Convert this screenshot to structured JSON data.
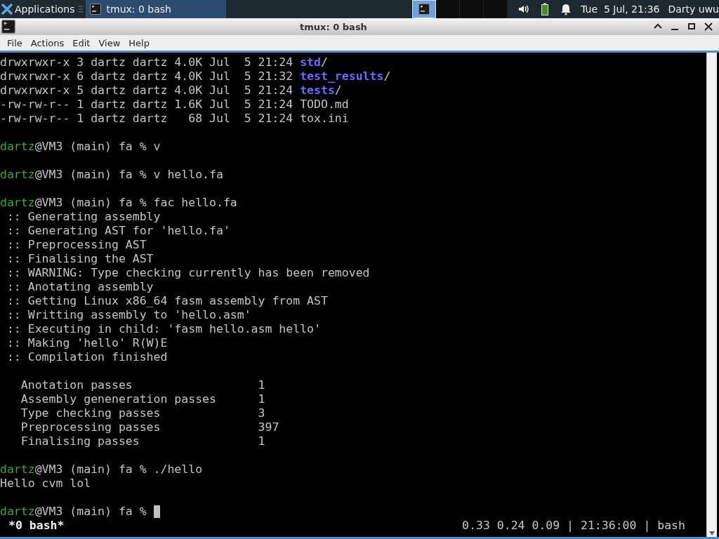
{
  "panel": {
    "applications_label": "Applications",
    "tasks": [
      {
        "title": "tmux: 0 bash",
        "selected": true
      }
    ],
    "workspaces": [
      {
        "selected": true
      },
      {
        "selected": false
      },
      {
        "selected": false
      },
      {
        "selected": false
      }
    ],
    "clock": "Tue  5 Jul, 21:36",
    "user": "Darty uwu"
  },
  "window": {
    "title": "tmux: 0 bash",
    "menu": [
      "File",
      "Actions",
      "Edit",
      "View",
      "Help"
    ]
  },
  "terminal": {
    "lines": [
      {
        "kind": "entry",
        "info": "drwxrwxr-x 3 dartz dartz 4.0K Jul  5 21:24 ",
        "name": "std",
        "is_dir": true,
        "suffix": "/"
      },
      {
        "kind": "entry",
        "info": "drwxrwxr-x 6 dartz dartz 4.0K Jul  5 21:32 ",
        "name": "test_results",
        "is_dir": true,
        "suffix": "/"
      },
      {
        "kind": "entry",
        "info": "drwxrwxr-x 5 dartz dartz 4.0K Jul  5 21:24 ",
        "name": "tests",
        "is_dir": true,
        "suffix": "/"
      },
      {
        "kind": "entry",
        "info": "-rw-rw-r-- 1 dartz dartz 1.6K Jul  5 21:24 ",
        "name": "TODO.md",
        "is_dir": false
      },
      {
        "kind": "entry",
        "info": "-rw-rw-r-- 1 dartz dartz   68 Jul  5 21:24 ",
        "name": "tox.ini",
        "is_dir": false
      },
      {
        "kind": "blank"
      },
      {
        "kind": "prompt",
        "user": "dartz",
        "rest": "@VM3 (main) fa % v",
        "cursor": false
      },
      {
        "kind": "blank"
      },
      {
        "kind": "prompt",
        "user": "dartz",
        "rest": "@VM3 (main) fa % v hello.fa",
        "cursor": false
      },
      {
        "kind": "blank"
      },
      {
        "kind": "prompt",
        "user": "dartz",
        "rest": "@VM3 (main) fa % fac hello.fa",
        "cursor": false
      },
      {
        "kind": "text",
        "text": " :: Generating assembly"
      },
      {
        "kind": "text",
        "text": " :: Generating AST for 'hello.fa'"
      },
      {
        "kind": "text",
        "text": " :: Preprocessing AST"
      },
      {
        "kind": "text",
        "text": " :: Finalising the AST"
      },
      {
        "kind": "text",
        "text": " :: WARNING: Type checking currently has been removed"
      },
      {
        "kind": "text",
        "text": " :: Anotating assembly"
      },
      {
        "kind": "text",
        "text": " :: Getting Linux x86_64 fasm assembly from AST"
      },
      {
        "kind": "text",
        "text": " :: Writting assembly to 'hello.asm'"
      },
      {
        "kind": "text",
        "text": " :: Executing in child: 'fasm hello.asm hello'"
      },
      {
        "kind": "text",
        "text": " :: Making 'hello' R(W)E"
      },
      {
        "kind": "text",
        "text": " :: Compilation finished"
      },
      {
        "kind": "blank"
      },
      {
        "kind": "text",
        "text": "   Anotation passes                  1"
      },
      {
        "kind": "text",
        "text": "   Assembly geneneration passes      1"
      },
      {
        "kind": "text",
        "text": "   Type checking passes              3"
      },
      {
        "kind": "text",
        "text": "   Preprocessing passes              397"
      },
      {
        "kind": "text",
        "text": "   Finalising passes                 1"
      },
      {
        "kind": "blank"
      },
      {
        "kind": "prompt",
        "user": "dartz",
        "rest": "@VM3 (main) fa % ./hello",
        "cursor": false
      },
      {
        "kind": "text",
        "text": "Hello cvm lol"
      },
      {
        "kind": "blank"
      },
      {
        "kind": "prompt",
        "user": "dartz",
        "rest": "@VM3 (main) fa % ",
        "cursor": true
      }
    ],
    "status": {
      "window_label": "*0 bash*",
      "info": "0.33 0.24 0.09 | 21:36:00 | bash"
    }
  }
}
